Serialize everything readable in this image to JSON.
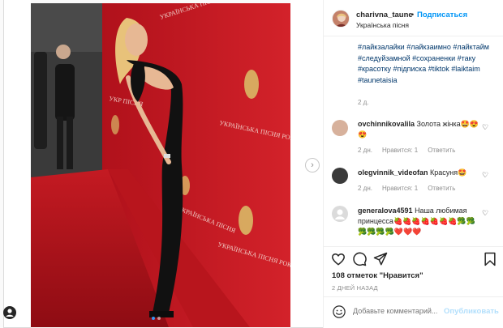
{
  "post": {
    "username": "charivna_taune",
    "follow_label": "Подписаться",
    "bullet": "•",
    "location": "Українська пісня",
    "hashtags": "#лайкзалайки #лайкзаимно #лайктайм #следуйзамной #сохраненки #таку #красотку #підписка #tiktok #laiktaim #taunetaisia",
    "caption_time": "2 д.",
    "likes": "108 отметок \"Нравится\"",
    "date": "2 ДНЕЙ НАЗАД",
    "photo_dots": 2,
    "photo_active_dot": 1
  },
  "comments": [
    {
      "user": "ovchinnikovalila",
      "text": "Золота жінка🤩😍😍",
      "time": "2 дн.",
      "likes_label": "Нравится: 1",
      "reply_label": "Ответить",
      "avatar_color": "#d7b19c"
    },
    {
      "user": "olegvinnik_videofan",
      "text": "Красуня🤩",
      "time": "2 дн.",
      "likes_label": "Нравится: 1",
      "reply_label": "Ответить",
      "avatar_color": "#3a3a3a"
    },
    {
      "user": "generalova4591",
      "text": "Наша любимая принцесса🍓🍓🍓🍓🍓🍓🍓🥦🥦🥦🥦🥦🥦❤️❤️❤️",
      "avatar_color": "#dbdbdb"
    }
  ],
  "composer": {
    "placeholder": "Добавьте комментарий...",
    "post_label": "Опубликовать"
  },
  "icons": {
    "next": "›",
    "heart": "heart-icon",
    "comment": "comment-icon",
    "share": "share-icon",
    "bookmark": "bookmark-icon",
    "emoji": "emoji-icon"
  },
  "colors": {
    "link": "#00376b",
    "follow": "#0095f6",
    "muted": "#8e8e8e",
    "post_disabled": "#b2dffc",
    "carpet": "#b5131c"
  }
}
